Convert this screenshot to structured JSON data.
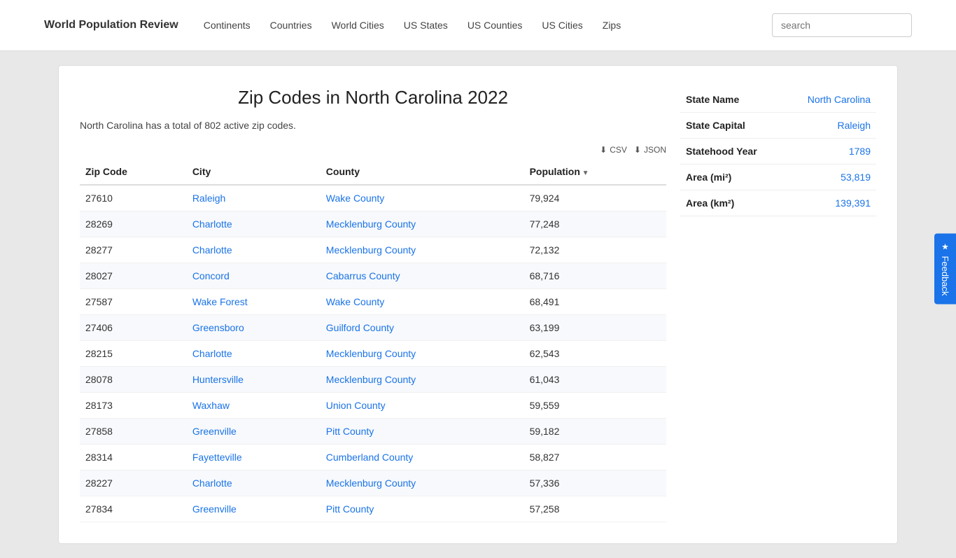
{
  "nav": {
    "brand": "World Population Review",
    "links": [
      {
        "label": "Continents",
        "href": "#"
      },
      {
        "label": "Countries",
        "href": "#"
      },
      {
        "label": "World Cities",
        "href": "#"
      },
      {
        "label": "US States",
        "href": "#"
      },
      {
        "label": "US Counties",
        "href": "#"
      },
      {
        "label": "US Cities",
        "href": "#"
      },
      {
        "label": "Zips",
        "href": "#"
      }
    ],
    "search_placeholder": "search"
  },
  "page": {
    "title": "Zip Codes in North Carolina 2022",
    "subtitle": "North Carolina has a total of 802 active zip codes.",
    "export_csv": "CSV",
    "export_json": "JSON"
  },
  "table": {
    "columns": [
      {
        "label": "Zip Code",
        "sortable": false
      },
      {
        "label": "City",
        "sortable": false
      },
      {
        "label": "County",
        "sortable": false
      },
      {
        "label": "Population",
        "sortable": true
      }
    ],
    "rows": [
      {
        "zip": "27610",
        "city": "Raleigh",
        "county": "Wake County",
        "population": "79,924"
      },
      {
        "zip": "28269",
        "city": "Charlotte",
        "county": "Mecklenburg County",
        "population": "77,248"
      },
      {
        "zip": "28277",
        "city": "Charlotte",
        "county": "Mecklenburg County",
        "population": "72,132"
      },
      {
        "zip": "28027",
        "city": "Concord",
        "county": "Cabarrus County",
        "population": "68,716"
      },
      {
        "zip": "27587",
        "city": "Wake Forest",
        "county": "Wake County",
        "population": "68,491"
      },
      {
        "zip": "27406",
        "city": "Greensboro",
        "county": "Guilford County",
        "population": "63,199"
      },
      {
        "zip": "28215",
        "city": "Charlotte",
        "county": "Mecklenburg County",
        "population": "62,543"
      },
      {
        "zip": "28078",
        "city": "Huntersville",
        "county": "Mecklenburg County",
        "population": "61,043"
      },
      {
        "zip": "28173",
        "city": "Waxhaw",
        "county": "Union County",
        "population": "59,559"
      },
      {
        "zip": "27858",
        "city": "Greenville",
        "county": "Pitt County",
        "population": "59,182"
      },
      {
        "zip": "28314",
        "city": "Fayetteville",
        "county": "Cumberland County",
        "population": "58,827"
      },
      {
        "zip": "28227",
        "city": "Charlotte",
        "county": "Mecklenburg County",
        "population": "57,336"
      },
      {
        "zip": "27834",
        "city": "Greenville",
        "county": "Pitt County",
        "population": "57,258"
      }
    ]
  },
  "sidebar": {
    "rows": [
      {
        "label": "State Name",
        "value": "North Carolina"
      },
      {
        "label": "State Capital",
        "value": "Raleigh"
      },
      {
        "label": "Statehood Year",
        "value": "1789"
      },
      {
        "label": "Area (mi²)",
        "value": "53,819"
      },
      {
        "label": "Area (km²)",
        "value": "139,391"
      }
    ]
  },
  "feedback": {
    "label": "Feedback"
  }
}
